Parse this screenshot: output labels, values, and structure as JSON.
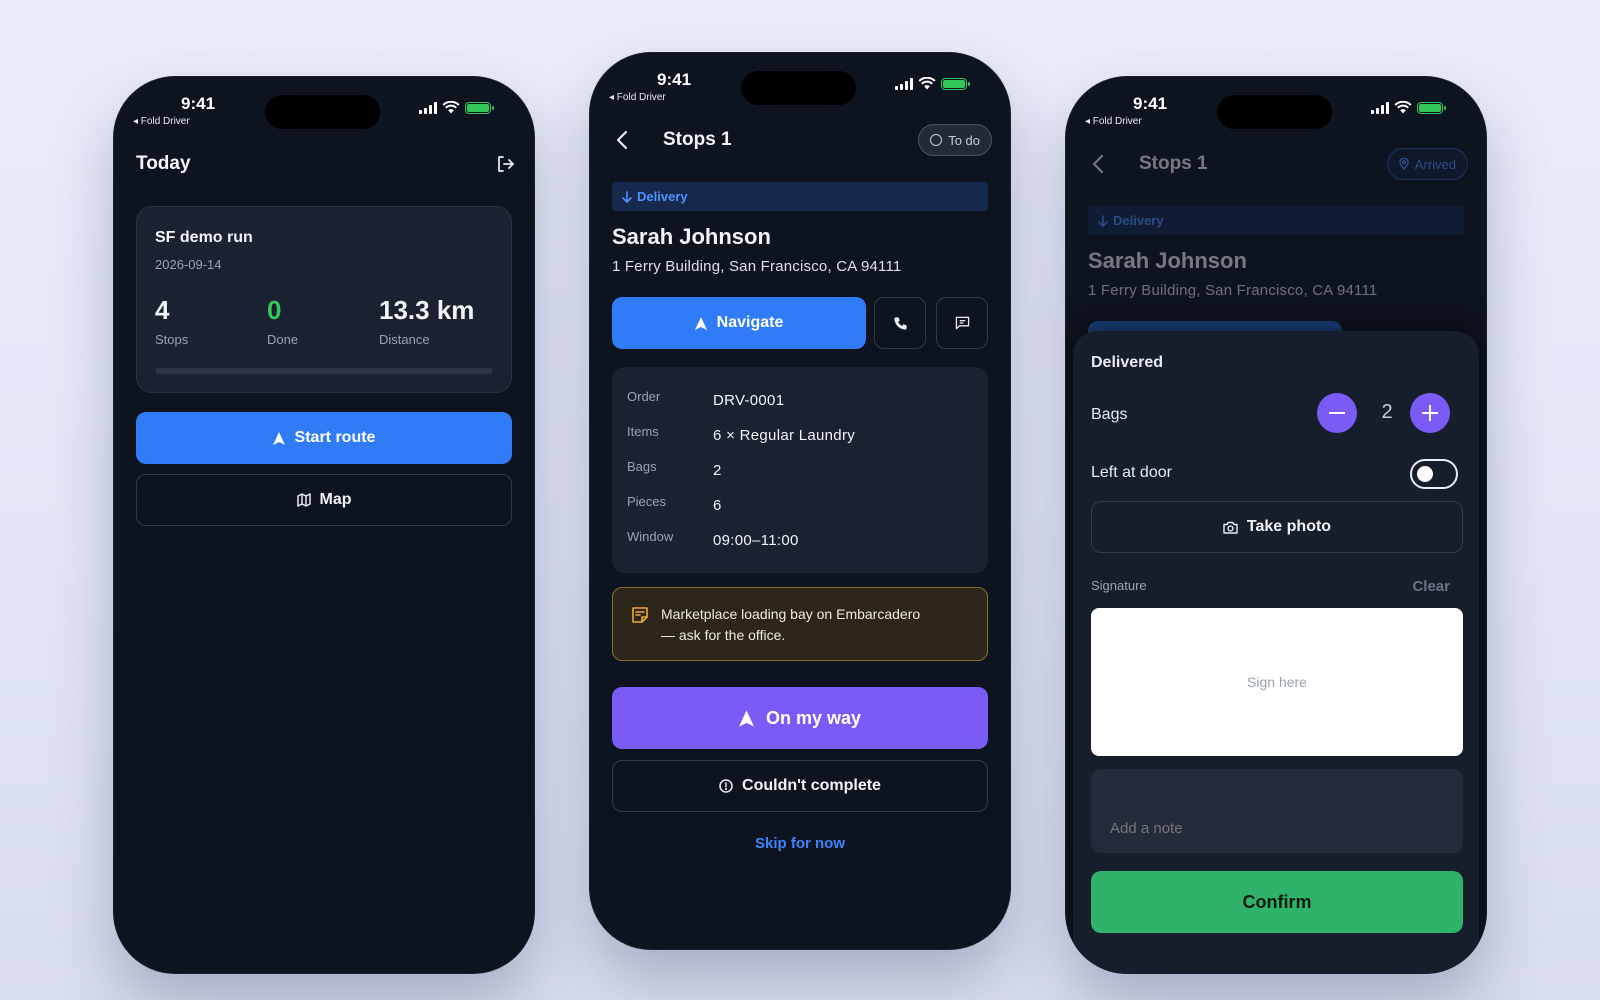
{
  "status_bar": {
    "time": "9:41",
    "back_app": "◂ Fold Driver"
  },
  "left": {
    "title": "Today",
    "route": {
      "name": "SF demo run",
      "date": "2026-09-14",
      "stats": [
        {
          "value": "4",
          "label": "Stops"
        },
        {
          "value": "0",
          "label": "Done"
        },
        {
          "value": "13.3 km",
          "label": "Distance"
        }
      ],
      "progress_fraction": 0
    },
    "start_label": "Start route",
    "map_label": "Map"
  },
  "mid": {
    "title": "Stops 1",
    "status_pill": "To do",
    "type_label": "Delivery",
    "customer_name": "Sarah Johnson",
    "address": "1 Ferry Building, San Francisco, CA 94111",
    "navigate_label": "Navigate",
    "order": [
      {
        "key": "Order",
        "value": "DRV-0001"
      },
      {
        "key": "Items",
        "value": "6 × Regular Laundry"
      },
      {
        "key": "Bags",
        "value": "2"
      },
      {
        "key": "Pieces",
        "value": "6"
      },
      {
        "key": "Window",
        "value": "09:00–11:00"
      }
    ],
    "note_line1": "Marketplace loading bay on Embarcadero",
    "note_line2": "— ask for the office.",
    "on_my_way_label": "On my way",
    "couldnt_label": "Couldn't complete",
    "skip_label": "Skip for now"
  },
  "right": {
    "title": "Stops 1",
    "status_pill": "Arrived",
    "type_label": "Delivery",
    "customer_name": "Sarah Johnson",
    "address": "1 Ferry Building, San Francisco, CA 94111",
    "sheet": {
      "heading": "Delivered",
      "bags_label": "Bags",
      "bags_count": "2",
      "left_at_door_label": "Left at door",
      "left_at_door_on": false,
      "photo_label": "Take photo",
      "signature_label": "Signature",
      "clear_label": "Clear",
      "sign_placeholder": "Sign here",
      "note_placeholder": "Add a note",
      "confirm_label": "Confirm"
    }
  },
  "colors": {
    "accent_blue": "#2f7cf6",
    "accent_purple": "#7a5bf5",
    "accent_green": "#2fb36b",
    "done_green": "#34c759",
    "background": "#0e1320"
  },
  "icons": {
    "logout": "logout-icon",
    "map": "map-icon",
    "navigation": "navigation-arrow-icon",
    "phone": "phone-icon",
    "message": "message-icon",
    "note": "note-icon",
    "alert": "alert-circle-icon",
    "camera": "camera-icon",
    "pin": "map-pin-icon",
    "minus": "minus-icon",
    "plus": "plus-icon"
  }
}
